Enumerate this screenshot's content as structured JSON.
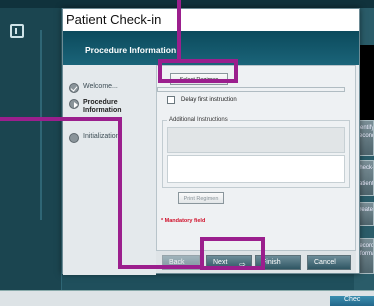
{
  "background": {
    "right_buttons": [
      "Identify Second",
      "Check-in Patient",
      "Create",
      "Record Informa"
    ],
    "footer_button": "Chec"
  },
  "dialog": {
    "title": "Patient Check-in",
    "header": "Procedure Information",
    "steps": [
      {
        "label": "Welcome...",
        "state": "done"
      },
      {
        "label": "Procedure Information",
        "state": "current"
      },
      {
        "label": "Initialization",
        "state": "pending"
      }
    ],
    "select_regimen_label": "Select Regimen",
    "delay_label": "Delay first instruction",
    "additional_label": "Additional Instructions",
    "print_regimen_label": "Print Regimen",
    "mandatory_label": "* Mandatory field",
    "footer": {
      "back_label": "Back",
      "next_label": "Next",
      "finish_label": "Finish",
      "cancel_label": "Cancel"
    }
  },
  "colors": {
    "highlight": "#9b1f8d",
    "header_band": "#0c4a5c",
    "mandatory": "#d0102a"
  }
}
